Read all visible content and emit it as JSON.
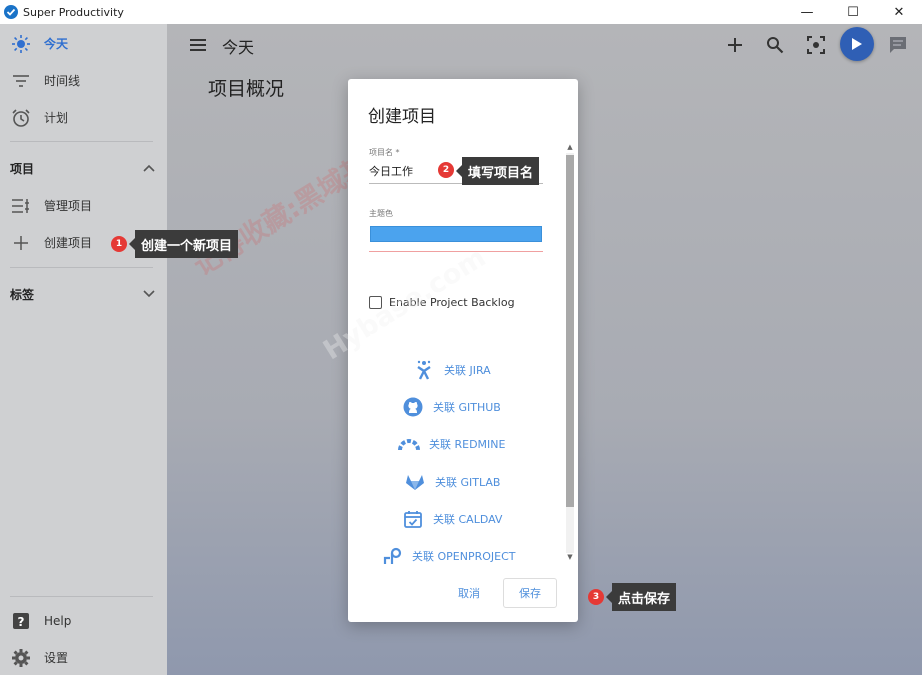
{
  "window": {
    "title": "Super Productivity",
    "controls": [
      "—",
      "☐",
      "✕"
    ]
  },
  "sidebar": {
    "items": [
      {
        "label": "今天",
        "icon": "sun-icon",
        "active": true
      },
      {
        "label": "时间线",
        "icon": "timeline-icon"
      },
      {
        "label": "计划",
        "icon": "alarm-clock-icon"
      }
    ],
    "projects_section": "项目",
    "project_items": [
      {
        "label": "管理项目",
        "icon": "list-settings-icon"
      },
      {
        "label": "创建项目",
        "icon": "plus-icon"
      }
    ],
    "tags_section": "标签",
    "bottom_items": [
      {
        "label": "Help",
        "icon": "help-icon"
      },
      {
        "label": "设置",
        "icon": "gear-icon"
      }
    ]
  },
  "header": {
    "title": "今天"
  },
  "main": {
    "heading": "项目概况"
  },
  "dialog": {
    "title": "创建项目",
    "name_label": "项目名 *",
    "name_value": "今日工作",
    "color_label": "主题色",
    "theme_color": "#4ba3ee",
    "backlog_label": "Enable Project Backlog",
    "integrations": [
      {
        "label": "关联 JIRA",
        "icon": "jira-icon"
      },
      {
        "label": "关联 GITHUB",
        "icon": "github-icon"
      },
      {
        "label": "关联 REDMINE",
        "icon": "redmine-icon"
      },
      {
        "label": "关联 GITLAB",
        "icon": "gitlab-icon"
      },
      {
        "label": "关联 CALDAV",
        "icon": "calendar-icon"
      },
      {
        "label": "关联 OPENPROJECT",
        "icon": "openproject-icon"
      }
    ],
    "cancel_label": "取消",
    "save_label": "保存"
  },
  "annotations": [
    {
      "number": "1",
      "text": "创建一个新项目"
    },
    {
      "number": "2",
      "text": "填写项目名"
    },
    {
      "number": "3",
      "text": "点击保存"
    }
  ],
  "watermark": {
    "line1": "记得收藏:黑域基地",
    "line2": "Hybase.com"
  },
  "colors": {
    "accent": "#2f6fd0",
    "link": "#4f8fdc",
    "sidebar_bg": "#cfd0d2",
    "badge": "#e53935",
    "callout": "#3b3b3b"
  }
}
